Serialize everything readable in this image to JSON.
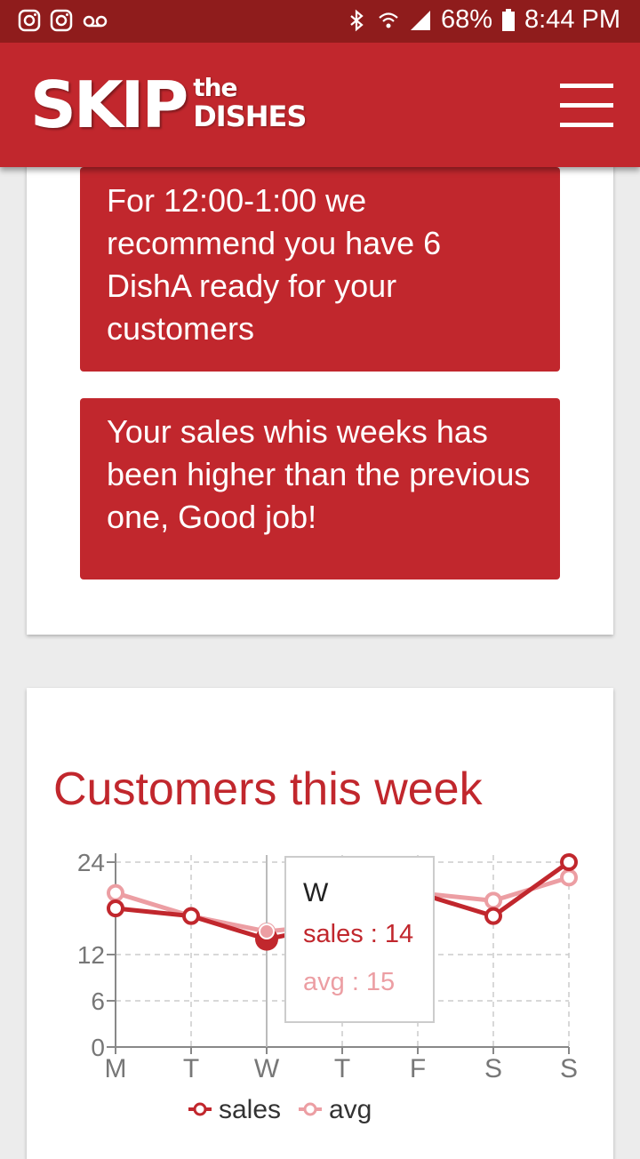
{
  "status_bar": {
    "battery": "68%",
    "time": "8:44 PM",
    "icons": [
      "instagram-icon",
      "instagram-icon",
      "voicemail-icon",
      "bluetooth-icon",
      "wifi-icon",
      "signal-icon",
      "battery-icon"
    ]
  },
  "header": {
    "logo_main": "SKIP",
    "logo_the": "the",
    "logo_dishes": "DISHES",
    "menu_icon": "hamburger-menu-icon"
  },
  "tips": [
    "For 12:00-1:00 we recommend you have 6 DishA ready for your customers",
    "Your sales whis weeks has been higher than the previous one, Good job!"
  ],
  "colors": {
    "brand": "#c1272d",
    "status_bar": "#8f1c1c",
    "avg_series": "#ec9ea3"
  },
  "chart_data": {
    "type": "line",
    "title": "Customers this week",
    "categories": [
      "M",
      "T",
      "W",
      "T",
      "F",
      "S",
      "S"
    ],
    "series": [
      {
        "name": "sales",
        "values": [
          18,
          17,
          14,
          16,
          20,
          17,
          24
        ],
        "color": "#c1272d"
      },
      {
        "name": "avg",
        "values": [
          20,
          17,
          15,
          16,
          20,
          19,
          22
        ],
        "color": "#ec9ea3"
      }
    ],
    "yticks": [
      0,
      6,
      12,
      24
    ],
    "ylim": [
      0,
      24
    ],
    "grid": true,
    "legend": "bottom",
    "tooltip": {
      "category": "W",
      "sales_label": "sales : 14",
      "avg_label": "avg : 15"
    }
  }
}
